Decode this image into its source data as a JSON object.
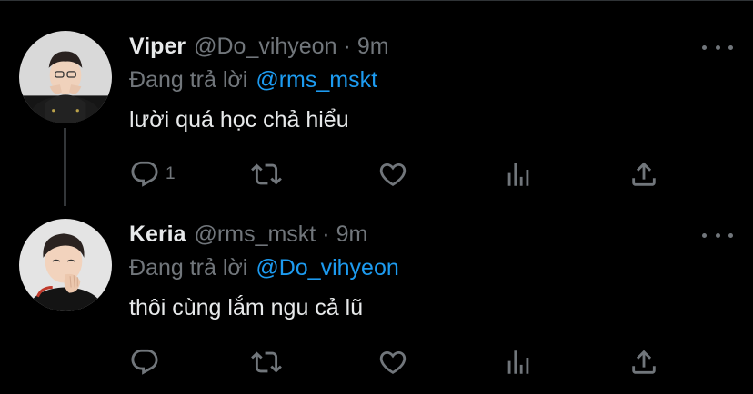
{
  "colors": {
    "background": "#000000",
    "primary_text": "#e7e9ea",
    "secondary_text": "#71767b",
    "link": "#1d9bf0",
    "thread_line": "#333639"
  },
  "tweets": [
    {
      "display_name": "Viper",
      "handle": "@Do_vihyeon",
      "separator": "·",
      "time": "9m",
      "replying_prefix": "Đang trả lời",
      "replying_to": "@rms_mskt",
      "text": "lười quá học chả hiểu",
      "reply_count": "1",
      "icons": [
        "reply-icon",
        "retweet-icon",
        "like-icon",
        "stats-icon",
        "share-icon",
        "more-icon"
      ]
    },
    {
      "display_name": "Keria",
      "handle": "@rms_mskt",
      "separator": "·",
      "time": "9m",
      "replying_prefix": "Đang trả lời",
      "replying_to": "@Do_vihyeon",
      "text": "thôi cùng lắm ngu cả lũ",
      "reply_count": "",
      "icons": [
        "reply-icon",
        "retweet-icon",
        "like-icon",
        "stats-icon",
        "share-icon",
        "more-icon"
      ]
    }
  ]
}
